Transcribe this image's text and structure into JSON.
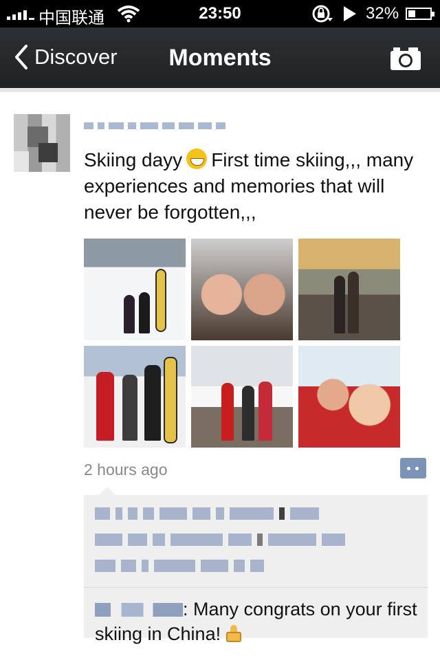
{
  "status_bar": {
    "carrier": "中国联通",
    "time": "23:50",
    "battery_percent": "32%",
    "battery_level": 0.32
  },
  "navbar": {
    "back_label": "Discover",
    "title": "Moments",
    "camera_icon": "camera-icon"
  },
  "post": {
    "text_part1": "Skiing dayy",
    "text_part2": "First time skiing,,, many experiences and memories that will never be forgotten,,,",
    "timestamp": "2 hours ago",
    "photos": [
      {
        "name": "skiing-photo-1"
      },
      {
        "name": "skiing-photo-2"
      },
      {
        "name": "skiing-photo-3"
      },
      {
        "name": "skiing-photo-4"
      },
      {
        "name": "skiing-photo-5"
      },
      {
        "name": "skiing-photo-6"
      }
    ],
    "comments": [
      {
        "text": "Many congrats on your first skiing in China!"
      }
    ]
  }
}
